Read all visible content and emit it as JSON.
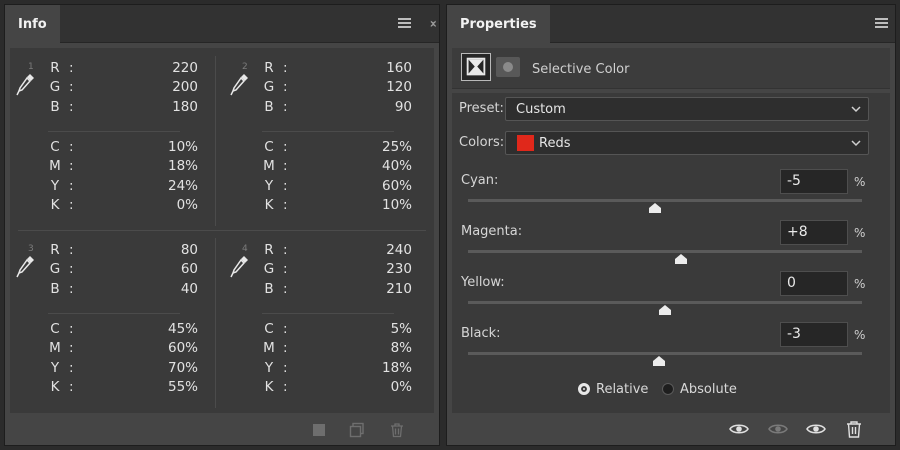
{
  "info_panel": {
    "tab_label": "Info",
    "readouts": [
      {
        "number": "1",
        "rgb": [
          [
            "R",
            "220"
          ],
          [
            "G",
            "200"
          ],
          [
            "B",
            "180"
          ]
        ],
        "cmyk": [
          [
            "C",
            "10%"
          ],
          [
            "M",
            "18%"
          ],
          [
            "Y",
            "24%"
          ],
          [
            "K",
            "0%"
          ]
        ]
      },
      {
        "number": "2",
        "rgb": [
          [
            "R",
            "160"
          ],
          [
            "G",
            "120"
          ],
          [
            "B",
            "90"
          ]
        ],
        "cmyk": [
          [
            "C",
            "25%"
          ],
          [
            "M",
            "40%"
          ],
          [
            "Y",
            "60%"
          ],
          [
            "K",
            "10%"
          ]
        ]
      },
      {
        "number": "3",
        "rgb": [
          [
            "R",
            "80"
          ],
          [
            "G",
            "60"
          ],
          [
            "B",
            "40"
          ]
        ],
        "cmyk": [
          [
            "C",
            "45%"
          ],
          [
            "M",
            "60%"
          ],
          [
            "Y",
            "70%"
          ],
          [
            "K",
            "55%"
          ]
        ]
      },
      {
        "number": "4",
        "rgb": [
          [
            "R",
            "240"
          ],
          [
            "G",
            "230"
          ],
          [
            "B",
            "210"
          ]
        ],
        "cmyk": [
          [
            "C",
            "5%"
          ],
          [
            "M",
            "8%"
          ],
          [
            "Y",
            "18%"
          ],
          [
            "K",
            "0%"
          ]
        ]
      }
    ],
    "colon": ":"
  },
  "properties_panel": {
    "tab_label": "Properties",
    "adjustment_title": "Selective Color",
    "preset": {
      "label": "Preset:",
      "value": "Custom"
    },
    "colors": {
      "label": "Colors:",
      "value": "Reds",
      "swatch_color": "#e0281b"
    },
    "sliders": [
      {
        "label": "Cyan:",
        "value": "-5",
        "unit": "%",
        "level": -5
      },
      {
        "label": "Magenta:",
        "value": "+8",
        "unit": "%",
        "level": 8
      },
      {
        "label": "Yellow:",
        "value": "0",
        "unit": "%",
        "level": 0
      },
      {
        "label": "Black:",
        "value": "-3",
        "unit": "%",
        "level": -3
      }
    ],
    "method": {
      "relative_label": "Relative",
      "absolute_label": "Absolute",
      "selected": "Relative"
    }
  },
  "icons": [
    "menu-icon",
    "collapse-icon",
    "eyedropper-icon",
    "stop-icon",
    "new-layer-icon",
    "trash-icon",
    "selective-color-icon",
    "layer-mask-icon",
    "chevron-down-icon",
    "eye-icon",
    "visibility-icon"
  ],
  "colors": {
    "panel_bg": "#454545",
    "content_bg": "#3a3a3a",
    "tabbar_bg": "#323232",
    "reds_swatch": "#e0281b"
  }
}
